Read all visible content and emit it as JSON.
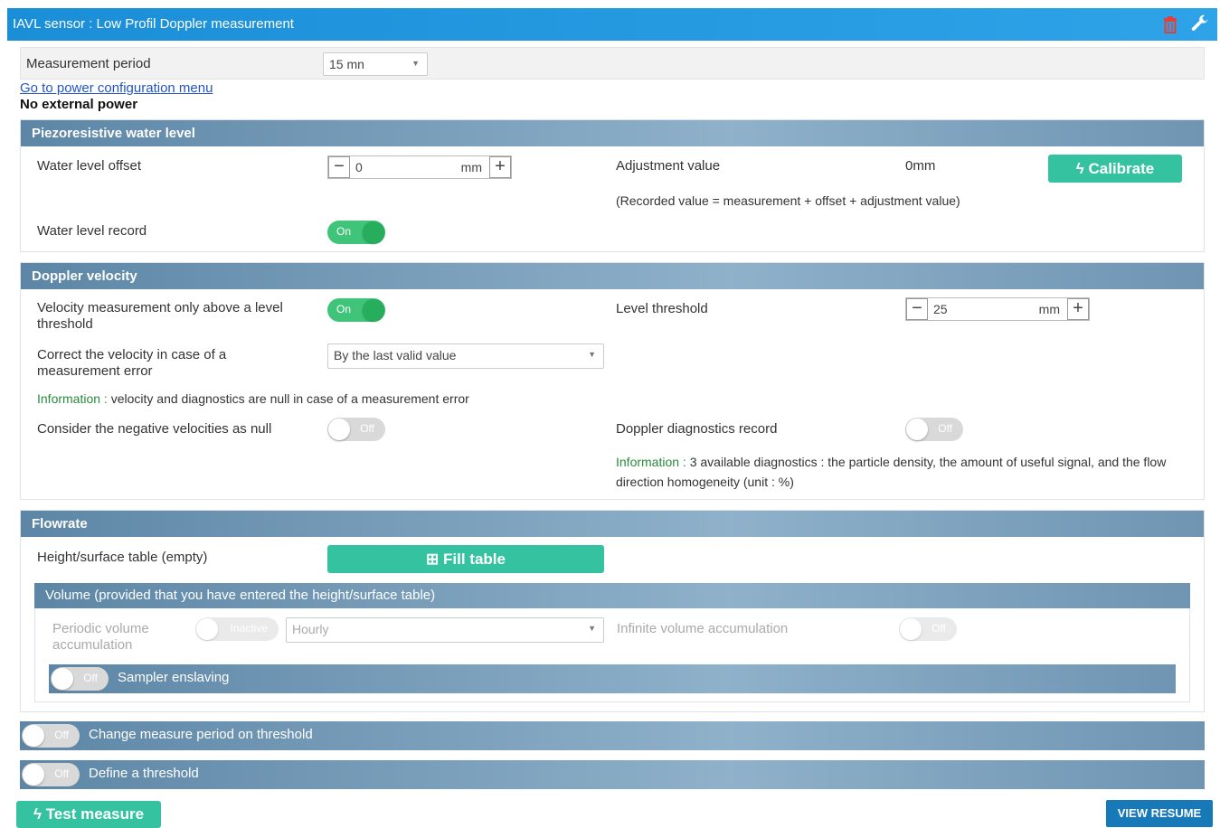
{
  "header": {
    "title": "IAVL sensor : Low Profil Doppler measurement"
  },
  "measurement_period": {
    "label": "Measurement period",
    "value": "15 mn"
  },
  "power": {
    "link": "Go to power configuration menu",
    "status": "No external power"
  },
  "piezo": {
    "title": "Piezoresistive water level",
    "offset_label": "Water level offset",
    "offset_value": "0",
    "offset_unit": "mm",
    "adjustment_label": "Adjustment value",
    "adjustment_value": "0mm",
    "calibrate_label": "Calibrate",
    "formula": "(Recorded value = measurement + offset + adjustment value)",
    "record_label": "Water level record",
    "record_toggle": "On"
  },
  "doppler": {
    "title": "Doppler velocity",
    "velocity_above_label": "Velocity measurement only above a level threshold",
    "velocity_above_toggle": "On",
    "threshold_label": "Level threshold",
    "threshold_value": "25",
    "threshold_unit": "mm",
    "correct_label": "Correct the velocity in case of a measurement error",
    "correct_value": "By the last valid value",
    "info1_key": "Information :",
    "info1_text": " velocity and diagnostics are null in case of a measurement error",
    "negative_label": "Consider the negative velocities as null",
    "negative_toggle": "Off",
    "diag_label": "Doppler diagnostics record",
    "diag_toggle": "Off",
    "info2_key": "Information :",
    "info2_text": " 3 available diagnostics : the particle density, the amount of useful signal, and the flow direction homogeneity (unit : %)"
  },
  "flowrate": {
    "title": "Flowrate",
    "table_label": "Height/surface table (empty)",
    "fill_label": "Fill table",
    "volume_title": "Volume (provided that you have entered the height/surface table)",
    "periodic_label": "Periodic volume accumulation",
    "periodic_toggle": "Inactive",
    "periodic_select": "Hourly",
    "infinite_label": "Infinite volume accumulation",
    "infinite_toggle": "Off",
    "sampler_toggle": "Off",
    "sampler_label": "Sampler enslaving"
  },
  "bars": {
    "change_toggle": "Off",
    "change_label": "Change measure period on threshold",
    "define_toggle": "Off",
    "define_label": "Define a threshold"
  },
  "footer": {
    "test_label": "Test measure",
    "resume_label": "VIEW RESUME"
  },
  "colors": {
    "header": "#1a8fd8",
    "section": "#6f95b3",
    "toggle_on": "#3fc47a",
    "button_green": "#35c2a0",
    "link": "#2455c3"
  }
}
